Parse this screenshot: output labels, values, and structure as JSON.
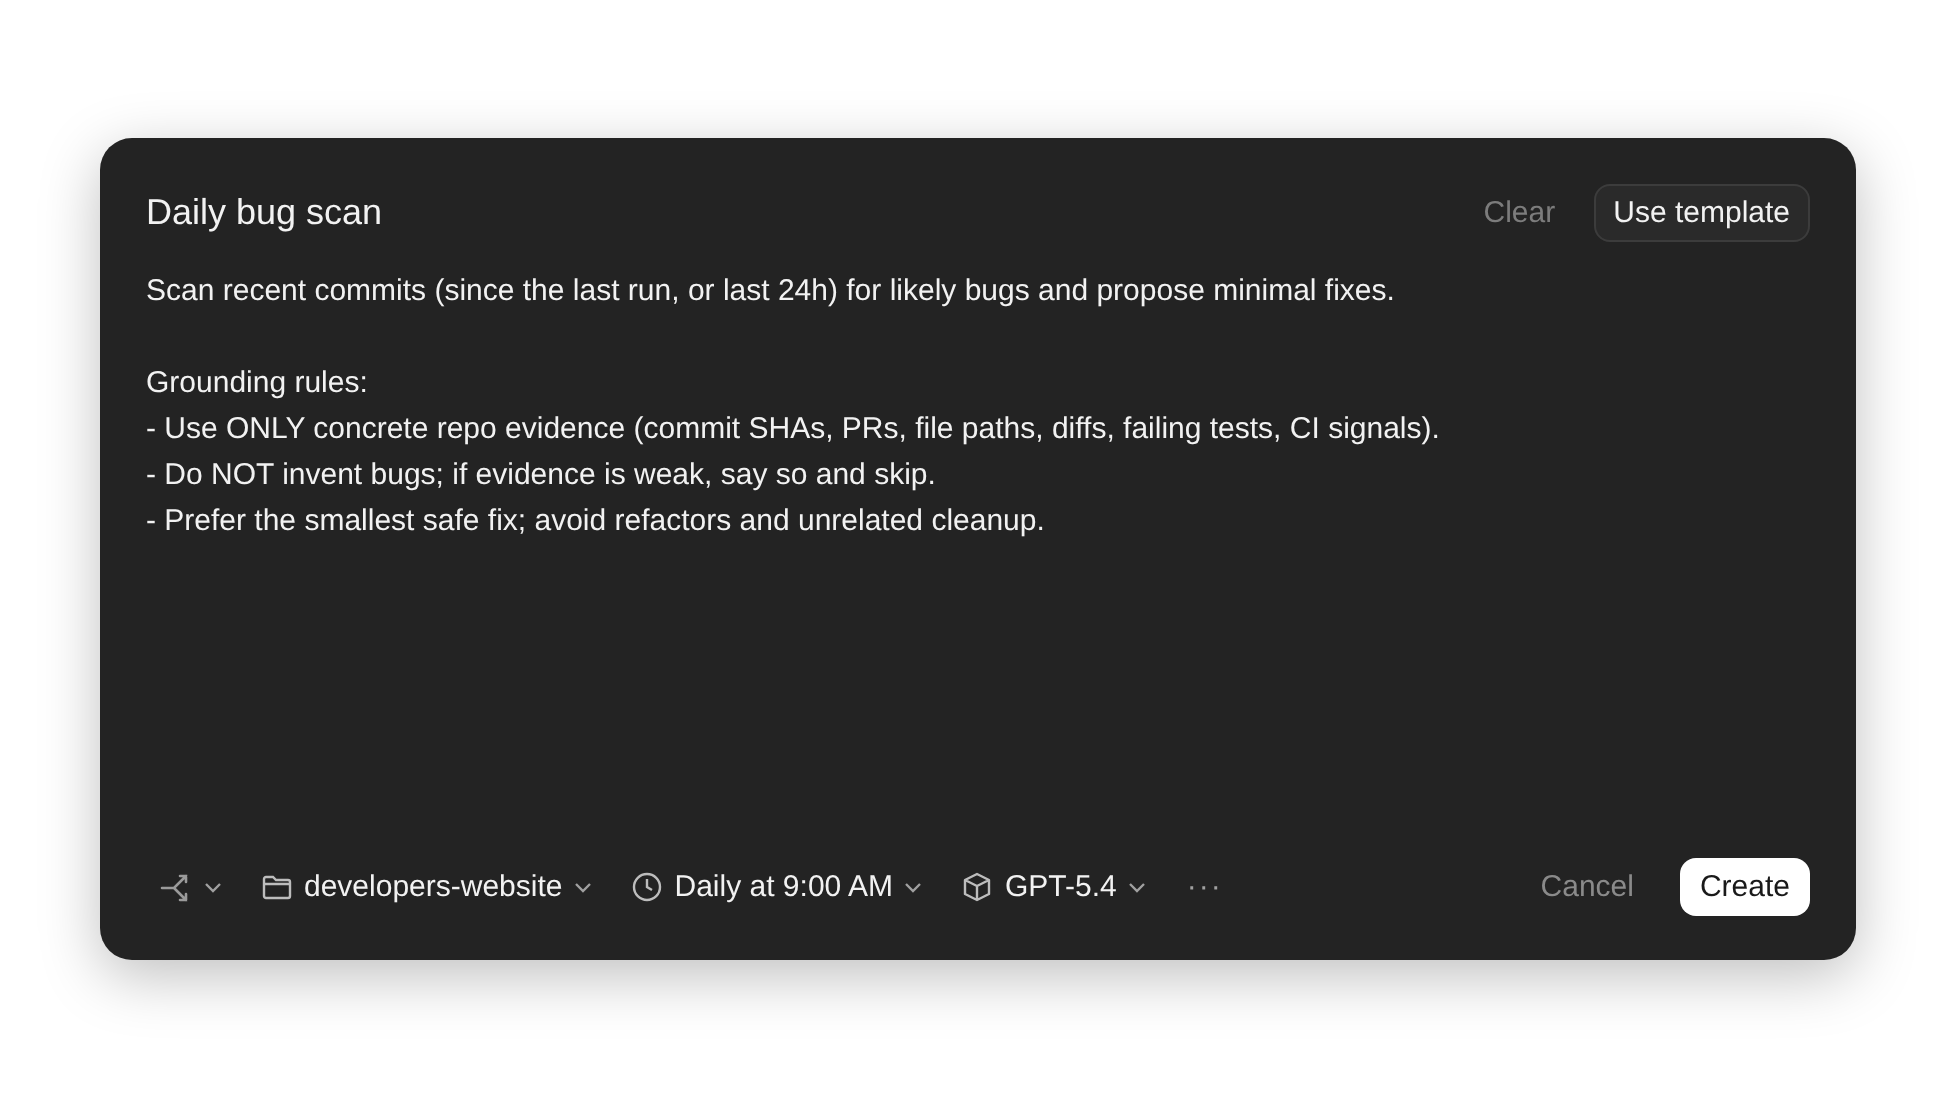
{
  "dialog": {
    "title": "Daily bug scan",
    "header_buttons": [
      {
        "label": "Clear",
        "kind": "text",
        "disabled": true
      },
      {
        "label": "Use template",
        "kind": "outlined",
        "disabled": false
      }
    ],
    "prompt_paragraphs": [
      [
        "Scan recent commits (since the last run, or last 24h) for likely bugs and propose minimal fixes."
      ],
      [
        "Grounding rules:",
        "- Use ONLY concrete repo evidence (commit SHAs, PRs, file paths, diffs, failing tests, CI signals).",
        "- Do NOT invent bugs; if evidence is weak, say so and skip.",
        "- Prefer the smallest safe fix; avoid refactors and unrelated cleanup."
      ]
    ],
    "toolbar": [
      {
        "kind": "branch"
      },
      {
        "kind": "folder",
        "label": "developers-website"
      },
      {
        "kind": "clock",
        "label": "Daily at 9:00 AM"
      },
      {
        "kind": "model",
        "label": "GPT-5.4"
      },
      {
        "kind": "more",
        "label": "···"
      }
    ],
    "footer_buttons": [
      {
        "label": "Cancel",
        "kind": "secondary"
      },
      {
        "label": "Create",
        "kind": "primary"
      }
    ]
  }
}
